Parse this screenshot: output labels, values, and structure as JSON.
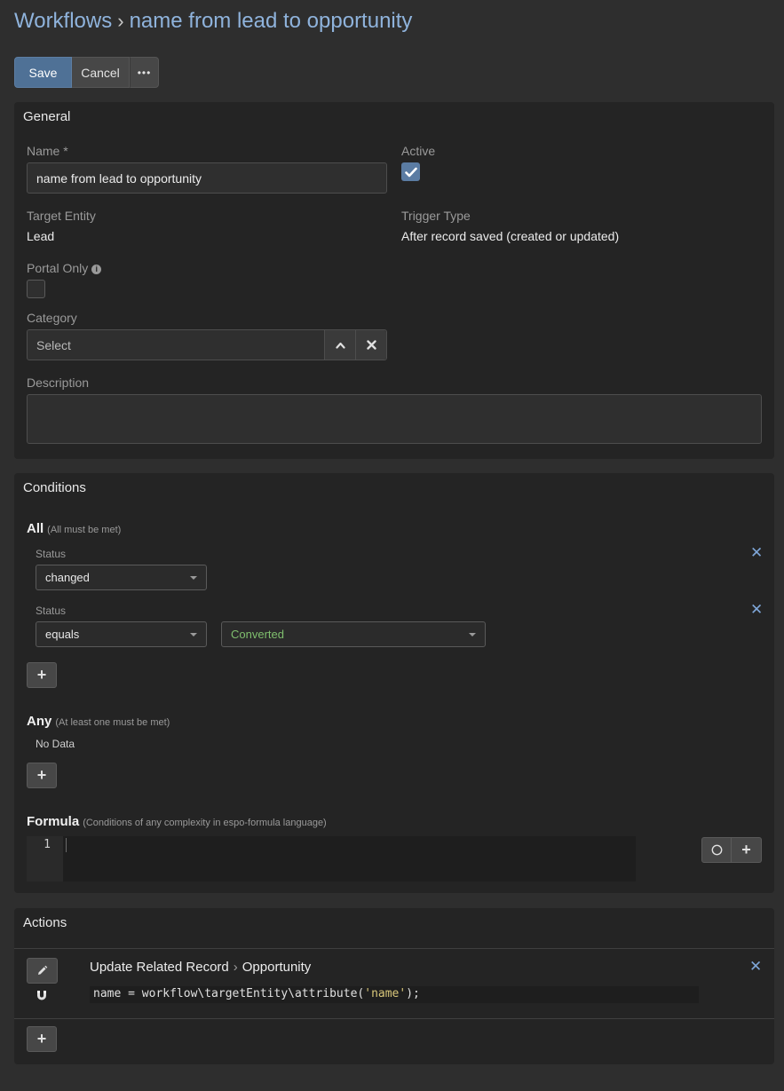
{
  "breadcrumb": {
    "root": "Workflows",
    "separator": "›",
    "current": "name from lead to opportunity"
  },
  "toolbar": {
    "save_label": "Save",
    "cancel_label": "Cancel",
    "more_label": "•••"
  },
  "general": {
    "title": "General",
    "name_label": "Name *",
    "name_value": "name from lead to opportunity",
    "active_label": "Active",
    "active_checked": true,
    "target_entity_label": "Target Entity",
    "target_entity_value": "Lead",
    "trigger_type_label": "Trigger Type",
    "trigger_type_value": "After record saved (created or updated)",
    "portal_only_label": "Portal Only",
    "portal_only_info": "i",
    "portal_only_checked": false,
    "category_label": "Category",
    "category_placeholder": "Select",
    "description_label": "Description",
    "description_value": ""
  },
  "conditions": {
    "title": "Conditions",
    "all_title": "All",
    "all_hint": "(All must be met)",
    "all_items": [
      {
        "field": "Status",
        "operator": "changed"
      },
      {
        "field": "Status",
        "operator": "equals",
        "value": "Converted"
      }
    ],
    "any_title": "Any",
    "any_hint": "(At least one must be met)",
    "any_empty": "No Data",
    "formula_title": "Formula",
    "formula_hint": "(Conditions of any complexity in espo-formula language)",
    "formula_line_number": "1",
    "add_icon": "+",
    "remove_icon": "✕",
    "circle_icon": "○"
  },
  "actions": {
    "title": "Actions",
    "items": [
      {
        "type": "Update Related Record",
        "separator": "›",
        "target": "Opportunity",
        "code_prefix": "name = workflow\\targetEntity\\attribute(",
        "code_string": "'name'",
        "code_suffix": ");"
      }
    ]
  },
  "colors": {
    "accent": "#8fb3dc",
    "save": "#4f7196",
    "converted": "#7fbf6e",
    "remove": "#7ea6d8"
  }
}
